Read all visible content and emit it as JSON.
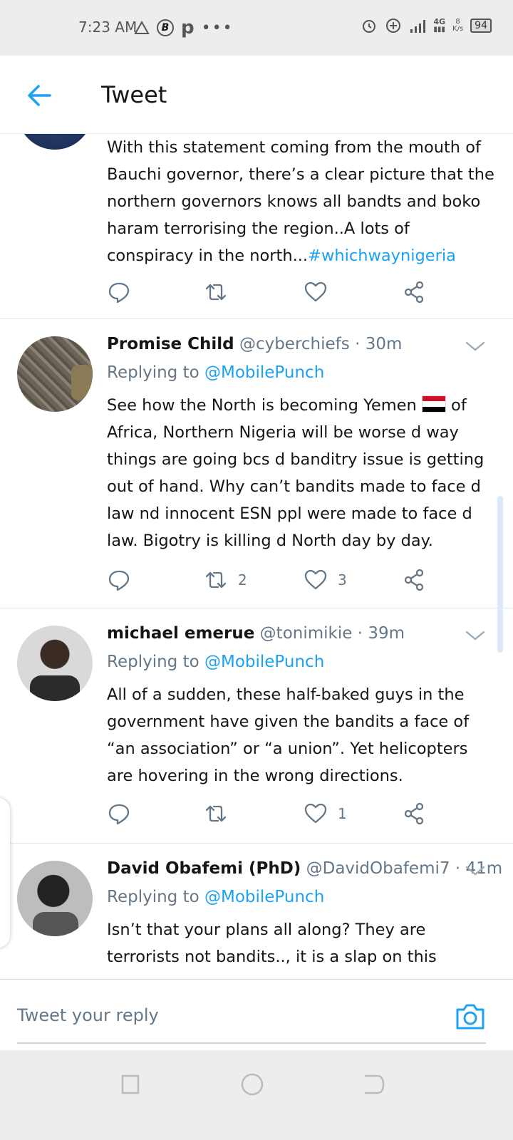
{
  "status_bar": {
    "time": "7:23 AM",
    "left_icons": [
      "drive-icon",
      "b-circle-icon",
      "p-icon",
      "more-dots-icon"
    ],
    "network": "4G",
    "speed_value": "8",
    "speed_unit": "K/s",
    "battery": "94"
  },
  "header": {
    "title": "Tweet"
  },
  "tweets": [
    {
      "body": "With this statement coming from the mouth of Bauchi governor, there’s a clear picture that the northern governors knows all bandts and boko haram terrorising the region..A lots of conspiracy in the north...",
      "hashtag": "#whichwaynigeria",
      "retweets": "",
      "likes": ""
    },
    {
      "name": "Promise Child",
      "handle": "@cyberchiefs",
      "time": "· 30m",
      "replying_prefix": "Replying to",
      "replying_to": "@MobilePunch",
      "body_before_flag": "See how the North is becoming Yemen",
      "body_after_flag": "of Africa, Northern Nigeria will be worse  d way things are going bcs d banditry issue is getting out of hand. Why can’t bandits made to face d law nd innocent ESN ppl were made to face d law. Bigotry is killing d North day by day.",
      "retweets": "2",
      "likes": "3"
    },
    {
      "name": "michael emerue",
      "handle": "@tonimikie",
      "time": "· 39m",
      "replying_prefix": "Replying to",
      "replying_to": "@MobilePunch",
      "body": "All of a sudden, these half-baked guys in the government have given the bandits a face of “an association” or “a union”. Yet helicopters are hovering in the wrong directions.",
      "retweets": "",
      "likes": "1"
    },
    {
      "name": "David Obafemi (PhD)",
      "handle": "@DavidObafemi7",
      "time": "· 41m",
      "replying_prefix": "Replying to",
      "replying_to": "@MobilePunch",
      "body": "Isn’t that your plans all along? They are terrorists not bandits.., it is a slap on this"
    }
  ],
  "reply_bar": {
    "placeholder": "Tweet your reply"
  },
  "colors": {
    "accent": "#1da1f2",
    "muted": "#657786",
    "text": "#14171a"
  }
}
